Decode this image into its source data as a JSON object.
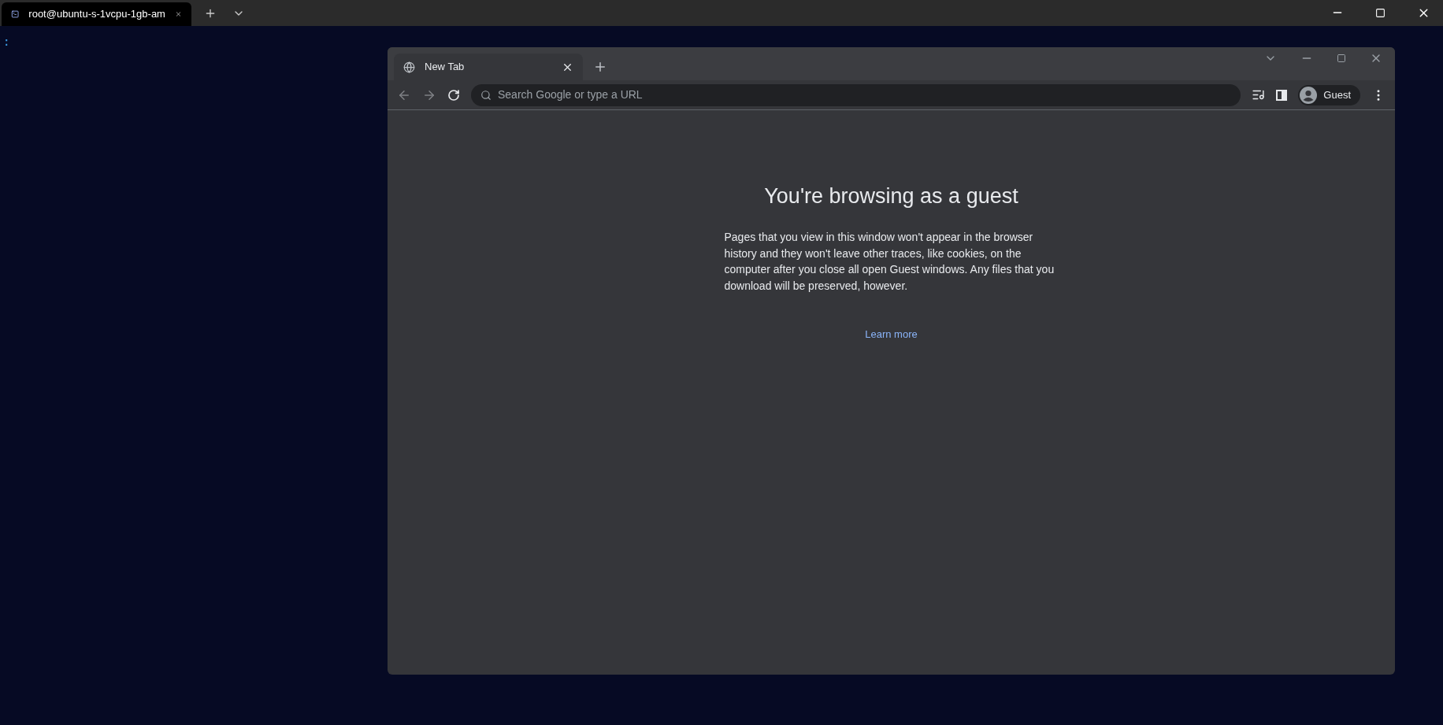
{
  "terminal": {
    "tabs": [
      {
        "title": "root@ubuntu-s-1vcpu-1gb-am",
        "selected": true
      }
    ],
    "prompt": ":"
  },
  "browser": {
    "tabs": [
      {
        "title": "New Tab",
        "selected": true
      }
    ],
    "back": {
      "disabled": true
    },
    "forward": {
      "disabled": true
    },
    "address_bar": {
      "placeholder": "Search Google or type a URL"
    },
    "profile": {
      "label": "Guest"
    },
    "page": {
      "title": "You're browsing as a guest",
      "body": "Pages that you view in this window won't appear in the browser history and they won't leave other traces, like cookies, on the computer after you close all open Guest windows. Any files that you download will be preserved, however.",
      "link": "Learn more"
    }
  }
}
